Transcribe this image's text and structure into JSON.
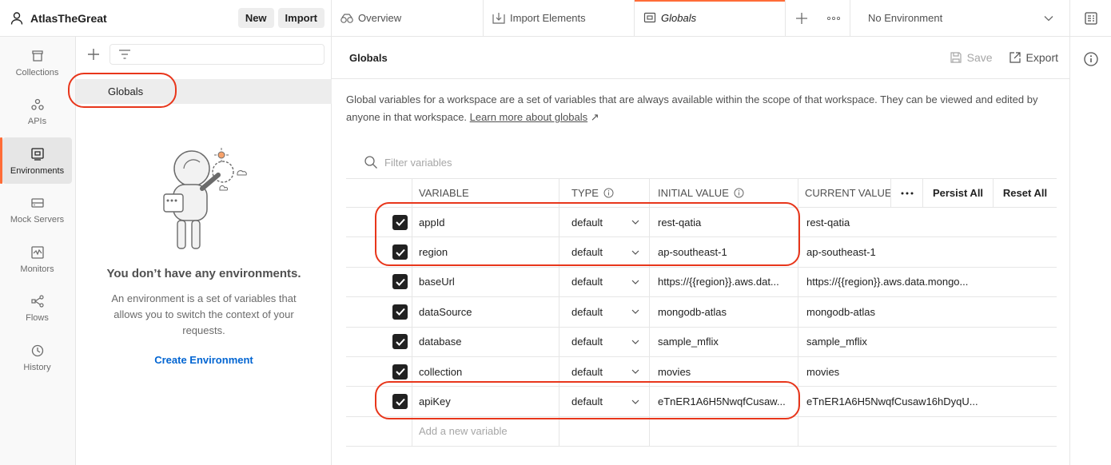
{
  "workspace": {
    "name": "AtlasTheGreat",
    "new_label": "New",
    "import_label": "Import"
  },
  "nav": [
    {
      "label": "Collections",
      "icon": "collections-icon",
      "active": false
    },
    {
      "label": "APIs",
      "icon": "apis-icon",
      "active": false
    },
    {
      "label": "Environments",
      "icon": "environments-icon",
      "active": true
    },
    {
      "label": "Mock Servers",
      "icon": "mock-servers-icon",
      "active": false
    },
    {
      "label": "Monitors",
      "icon": "monitors-icon",
      "active": false
    },
    {
      "label": "Flows",
      "icon": "flows-icon",
      "active": false
    },
    {
      "label": "History",
      "icon": "history-icon",
      "active": false
    }
  ],
  "env_panel": {
    "globals_label": "Globals",
    "empty_title": "You don’t have any environments.",
    "empty_desc": "An environment is a set of variables that allows you to switch the context of your requests.",
    "create_label": "Create Environment"
  },
  "tabs": [
    {
      "label": "Overview",
      "icon": "overview-icon"
    },
    {
      "label": "Import Elements",
      "icon": "import-icon"
    },
    {
      "label": "Globals",
      "icon": "globals-icon",
      "active": true
    }
  ],
  "env_select": {
    "value": "No Environment"
  },
  "main": {
    "title": "Globals",
    "save_label": "Save",
    "export_label": "Export",
    "description": "Global variables for a workspace are a set of variables that are always available within the scope of that workspace. They can be viewed and edited by anyone in that workspace.",
    "learn_more": "Learn more about globals",
    "filter_placeholder": "Filter variables",
    "columns": {
      "variable": "VARIABLE",
      "type": "TYPE",
      "initial": "INITIAL VALUE",
      "current": "CURRENT VALUE"
    },
    "persist_all": "Persist All",
    "reset_all": "Reset All",
    "add_placeholder": "Add a new variable",
    "rows": [
      {
        "name": "appId",
        "type": "default",
        "initial": "rest-qatia",
        "current": "rest-qatia"
      },
      {
        "name": "region",
        "type": "default",
        "initial": "ap-southeast-1",
        "current": "ap-southeast-1"
      },
      {
        "name": "baseUrl",
        "type": "default",
        "initial": "https://{{region}}.aws.dat...",
        "current": "https://{{region}}.aws.data.mongo..."
      },
      {
        "name": "dataSource",
        "type": "default",
        "initial": "mongodb-atlas",
        "current": "mongodb-atlas"
      },
      {
        "name": "database",
        "type": "default",
        "initial": "sample_mflix",
        "current": "sample_mflix"
      },
      {
        "name": "collection",
        "type": "default",
        "initial": "movies",
        "current": "movies"
      },
      {
        "name": "apiKey",
        "type": "default",
        "initial": "eTnER1A6H5NwqfCusaw...",
        "current": "eTnER1A6H5NwqfCusaw16hDyqU..."
      }
    ]
  },
  "colors": {
    "accent": "#ff6c37",
    "link": "#0265d2",
    "annotation": "#e8361b"
  }
}
